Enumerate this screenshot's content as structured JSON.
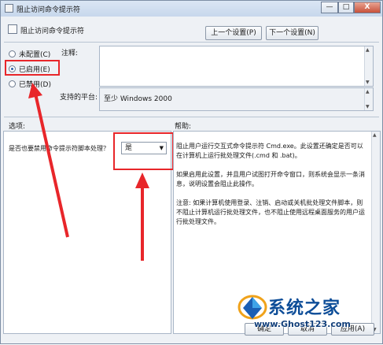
{
  "window": {
    "title": "阻止访问命令提示符",
    "minimize_glyph": "—",
    "maximize_glyph": "□",
    "close_glyph": "X"
  },
  "header": {
    "policy_title": "阻止访问命令提示符",
    "prev_button": "上一个设置(P)",
    "next_button": "下一个设置(N)"
  },
  "state": {
    "options": [
      {
        "label": "未配置(C)",
        "selected": false
      },
      {
        "label": "已启用(E)",
        "selected": true
      },
      {
        "label": "已禁用(D)",
        "selected": false
      }
    ]
  },
  "comment": {
    "label": "注释:",
    "value": ""
  },
  "platform": {
    "label": "支持的平台:",
    "value": "至少 Windows 2000"
  },
  "options_section": {
    "label": "选项:",
    "question": "是否也要禁用命令提示符脚本处理？",
    "dropdown_value": "是"
  },
  "help_section": {
    "label": "帮助:",
    "paragraphs": [
      "阻止用户运行交互式命令提示符 Cmd.exe。此设置还确定是否可以在计算机上运行批处理文件(.cmd 和 .bat)。",
      "如果启用此设置，并且用户试图打开命令窗口，则系统会显示一条消息，说明设置会阻止此操作。",
      "注意: 如果计算机使用登录、注销、启动或关机批处理文件脚本，则不阻止计算机运行批处理文件，也不阻止使用远程桌面服务的用户运行批处理文件。"
    ]
  },
  "footer": {
    "ok_button": "确定",
    "cancel_button": "取消",
    "apply_button": "应用(A)"
  },
  "watermark": {
    "title": "系统之家",
    "url": "www.Ghost123.com"
  },
  "colors": {
    "annotation_red": "#e8262a",
    "watermark_blue": "#0d4d98"
  }
}
